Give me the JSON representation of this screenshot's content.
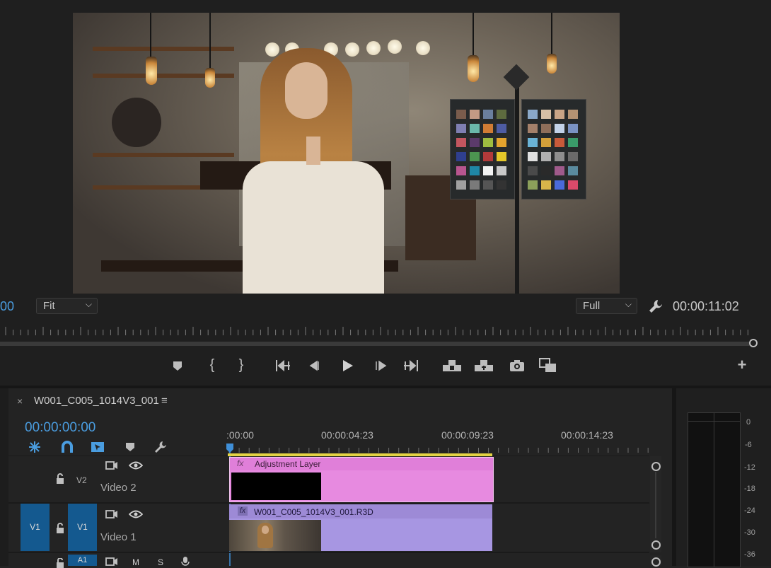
{
  "monitor": {
    "timecode_left": "00",
    "zoom_select": "Fit",
    "resolution_select": "Full",
    "duration": "00:00:11:02"
  },
  "transport": {
    "icons": [
      "marker-icon",
      "mark-in-icon",
      "mark-out-icon",
      "go-to-in-icon",
      "step-back-icon",
      "play-icon",
      "step-forward-icon",
      "go-to-out-icon",
      "lift-icon",
      "extract-icon",
      "camera-icon",
      "comparison-view-icon",
      "add-button-icon"
    ]
  },
  "timeline": {
    "sequence_name": "W001_C005_1014V3_001",
    "playhead_timecode": "00:00:00:00",
    "ruler_labels": [
      ":00:00",
      "00:00:04:23",
      "00:00:09:23",
      "00:00:14:23"
    ],
    "tracks": [
      {
        "id": "V2",
        "label": "Video 2"
      },
      {
        "id": "V1",
        "source": "V1",
        "label": "Video 1"
      },
      {
        "id": "A1",
        "label": "A1",
        "audio_buttons": [
          "M",
          "S"
        ]
      }
    ],
    "clips": {
      "adjustment": {
        "fx": "fx",
        "name": "Adjustment Layer"
      },
      "video": {
        "fx": "fx",
        "name": "W001_C005_1014V3_001.R3D"
      }
    }
  },
  "meter": {
    "scale": [
      "0",
      "-6",
      "-12",
      "-18",
      "-24",
      "-30",
      "-36"
    ]
  },
  "colors": {
    "accent": "#4a9de0",
    "pink_clip": "#e78ae0",
    "purple_clip": "#a796e2",
    "track_toggle": "#14598f",
    "yellow_bar": "#e4d444"
  }
}
